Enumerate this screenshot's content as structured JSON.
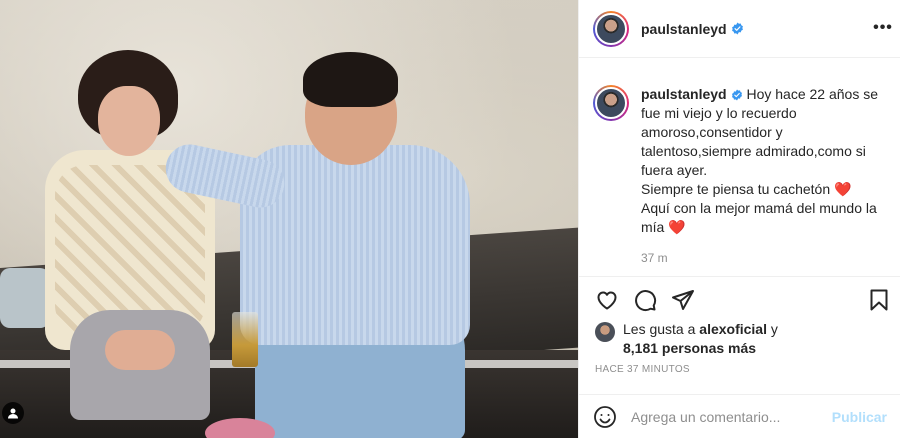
{
  "post": {
    "username": "paulstanleyd",
    "caption_lines": [
      "Hoy hace 22 años se",
      "fue mi viejo y lo recuerdo",
      "amoroso,consentidor y",
      "talentoso,siempre admirado,como si",
      "fuera ayer.",
      "Siempre te piensa tu cachetón",
      "Aquí con la mejor mamá del mundo la",
      "mía"
    ],
    "heart_emoji": "❤️",
    "caption_time": "37 m",
    "likes": {
      "prefix": "Les gusta a",
      "user": "alexoficial",
      "conjunction": "y",
      "others": "8,181 personas más"
    },
    "posted_ago": "HACE 37 MINUTOS",
    "comment": {
      "placeholder": "Agrega un comentario...",
      "publish_label": "Publicar"
    },
    "more_label": "•••"
  },
  "colors": {
    "verified": "#3897f0",
    "publish_disabled": "#b2dffc",
    "muted_text": "#8e8e8e"
  },
  "icons": [
    "verified-badge-icon",
    "more-options-icon",
    "heart-icon",
    "comment-icon",
    "share-icon",
    "bookmark-icon",
    "emoji-icon",
    "user-tag-icon"
  ]
}
